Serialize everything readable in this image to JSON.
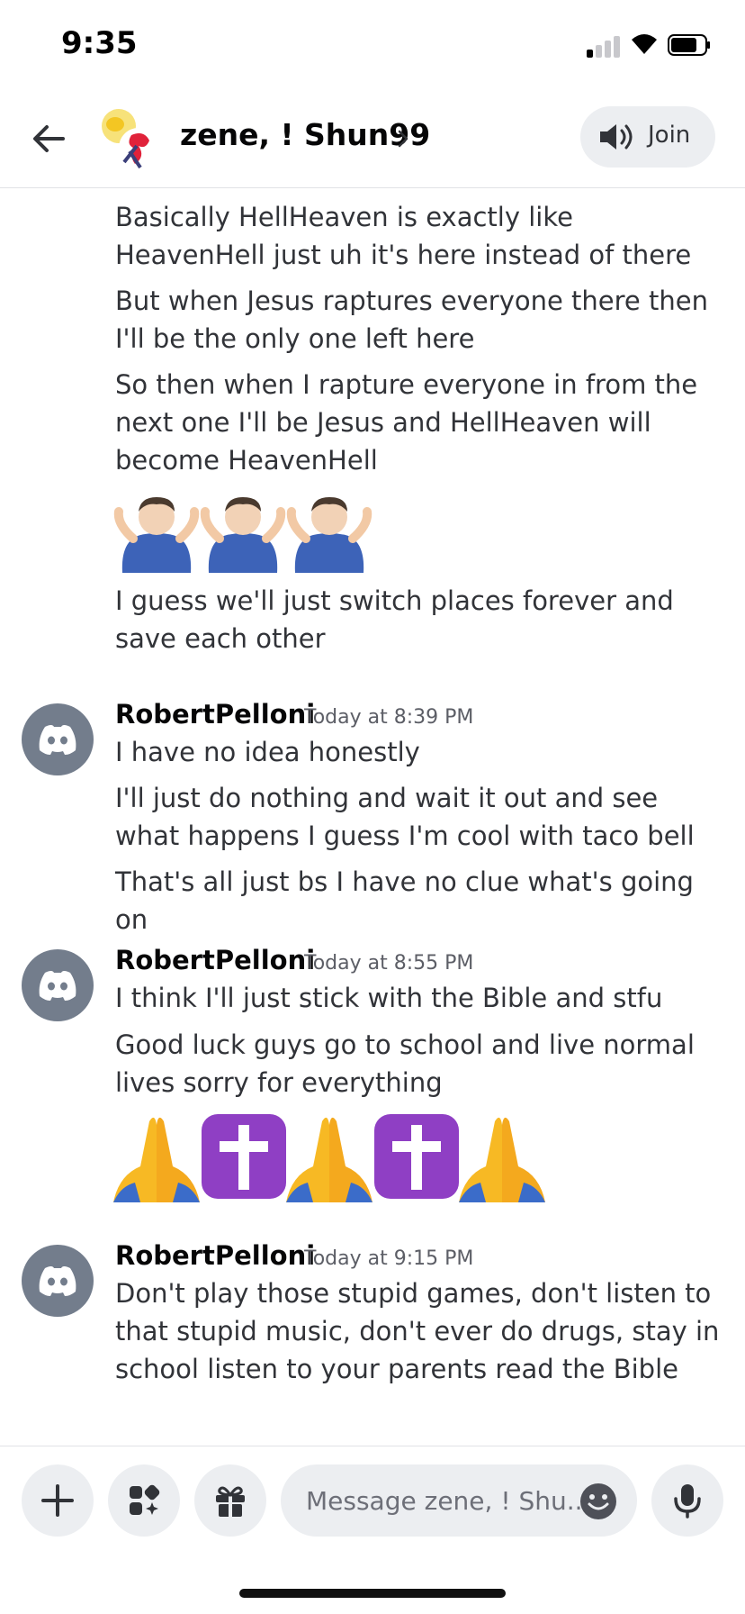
{
  "status_bar": {
    "time": "9:35",
    "signal_bars_active": 1,
    "signal_bars_total": 4,
    "battery_level": 0.7
  },
  "header": {
    "title": "zene, ! Shun99",
    "back_icon": "arrow-left-icon",
    "chevron_icon": "chevron-right-icon",
    "join_label": "Join",
    "join_icon": "speaker-icon"
  },
  "messages": {
    "continued": {
      "m1": "Basically HellHeaven is exactly like HeavenHell just uh it's here instead of there",
      "m2": "But when Jesus raptures everyone there then I'll be the only one left here",
      "m3": "So then when I rapture everyone in from the next one I'll be Jesus and HellHeaven will become HeavenHell",
      "emoji": "🤷🏻‍♂️🤷🏻‍♂️🤷🏻‍♂️",
      "m4": "I guess we'll just switch places forever and save each other"
    },
    "group1": {
      "author": "RobertPelloni",
      "timestamp": "Today at 8:39 PM",
      "m1": "I have no idea honestly",
      "m2": "I'll just do nothing and wait it out and see what happens I guess I'm cool with taco bell",
      "m3": "That's all just bs I have no clue what's going on"
    },
    "group2": {
      "author": "RobertPelloni",
      "timestamp": "Today at 8:55 PM",
      "m1": "I think I'll just stick with the Bible and stfu",
      "m2": "Good luck guys go to school and live normal lives sorry for everything",
      "emoji": "🙏✝️🙏✝️🙏"
    },
    "group3": {
      "author": "RobertPelloni",
      "timestamp": "Today at 9:15 PM",
      "m1": "Don't play those stupid games, don't listen to that stupid music, don't ever do drugs, stay in school listen to your parents read the Bible"
    }
  },
  "composer": {
    "placeholder": "Message zene, ! Shu...",
    "add_icon": "plus-icon",
    "apps_icon": "apps-icon",
    "gift_icon": "gift-icon",
    "emoji_icon": "emoji-icon",
    "mic_icon": "microphone-icon"
  },
  "colors": {
    "accent_avatar": "#737d8c",
    "button_bg": "#eceef1",
    "text": "#313338",
    "muted": "#5c5e66"
  }
}
